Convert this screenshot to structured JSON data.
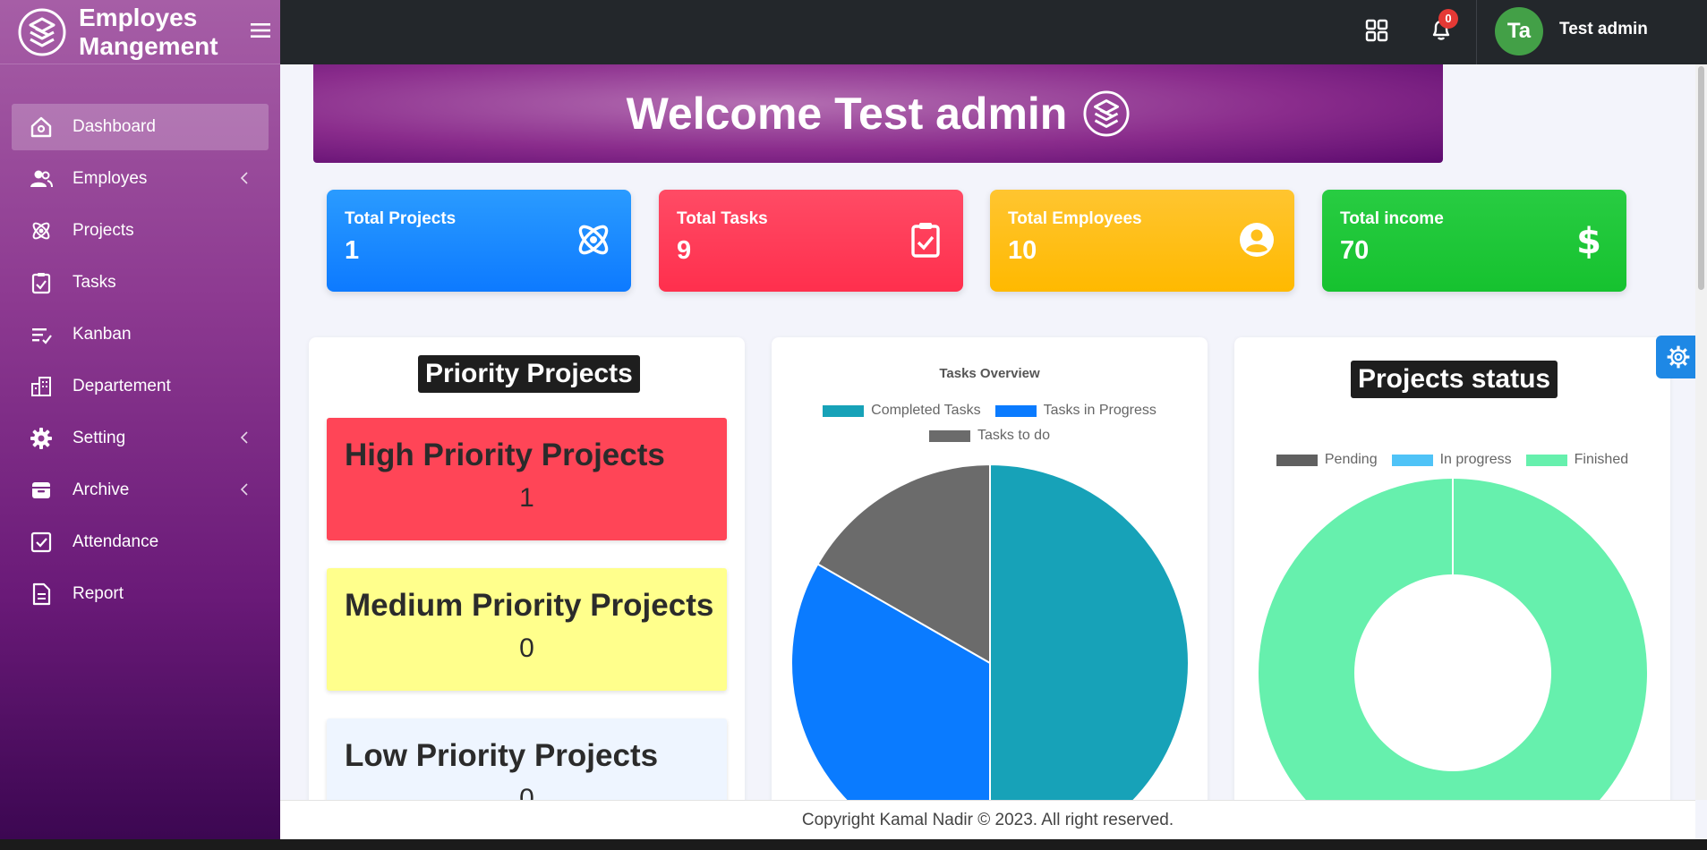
{
  "app": {
    "title": "Employes Mangement"
  },
  "sidebar": {
    "items": [
      {
        "label": "Dashboard",
        "icon": "home-icon",
        "active": true
      },
      {
        "label": "Employes",
        "icon": "users-icon",
        "has_submenu": true
      },
      {
        "label": "Projects",
        "icon": "atom-icon"
      },
      {
        "label": "Tasks",
        "icon": "clipboard-check-icon"
      },
      {
        "label": "Kanban",
        "icon": "list-check-icon"
      },
      {
        "label": "Departement",
        "icon": "building-icon"
      },
      {
        "label": "Setting",
        "icon": "gear-icon",
        "has_submenu": true
      },
      {
        "label": "Archive",
        "icon": "archive-icon",
        "has_submenu": true
      },
      {
        "label": "Attendance",
        "icon": "check-square-icon"
      },
      {
        "label": "Report",
        "icon": "file-icon"
      }
    ]
  },
  "topbar": {
    "notifications_count": "0",
    "avatar_initials": "Ta",
    "user_name": "Test admin"
  },
  "welcome": {
    "text": "Welcome Test admin"
  },
  "stats": [
    {
      "label": "Total Projects",
      "value": "1",
      "icon": "atom-icon",
      "color": "#1a8cff"
    },
    {
      "label": "Total Tasks",
      "value": "9",
      "icon": "clipboard-check-icon",
      "color": "#ff3b58"
    },
    {
      "label": "Total Employees",
      "value": "10",
      "icon": "user-circle-icon",
      "color": "#ffbf1a"
    },
    {
      "label": "Total income",
      "value": "70",
      "icon": "dollar-icon",
      "color": "#1fc738"
    }
  ],
  "priority": {
    "title": "Priority Projects",
    "high": {
      "label": "High Priority Projects",
      "value": "1"
    },
    "medium": {
      "label": "Medium Priority Projects",
      "value": "0"
    },
    "low": {
      "label": "Low Priority Projects",
      "value": "0"
    }
  },
  "projects_status": {
    "title": "Projects status"
  },
  "chart_data": [
    {
      "type": "pie",
      "title": "Tasks Overview",
      "categories": [
        "Completed Tasks",
        "Tasks in Progress",
        "Tasks to do"
      ],
      "values": [
        50,
        33.3,
        16.7
      ],
      "colors": [
        "#17a2b8",
        "#0a7bff",
        "#6b6b6b"
      ],
      "legend": "top"
    },
    {
      "type": "pie",
      "donut": true,
      "categories": [
        "Pending",
        "In progress",
        "Finished"
      ],
      "values": [
        0,
        0,
        1
      ],
      "colors": [
        "#606060",
        "#4fc3f7",
        "#66f0ad"
      ],
      "legend": "top"
    }
  ],
  "footer": {
    "text": "Copyright Kamal Nadir © 2023. All right reserved."
  }
}
